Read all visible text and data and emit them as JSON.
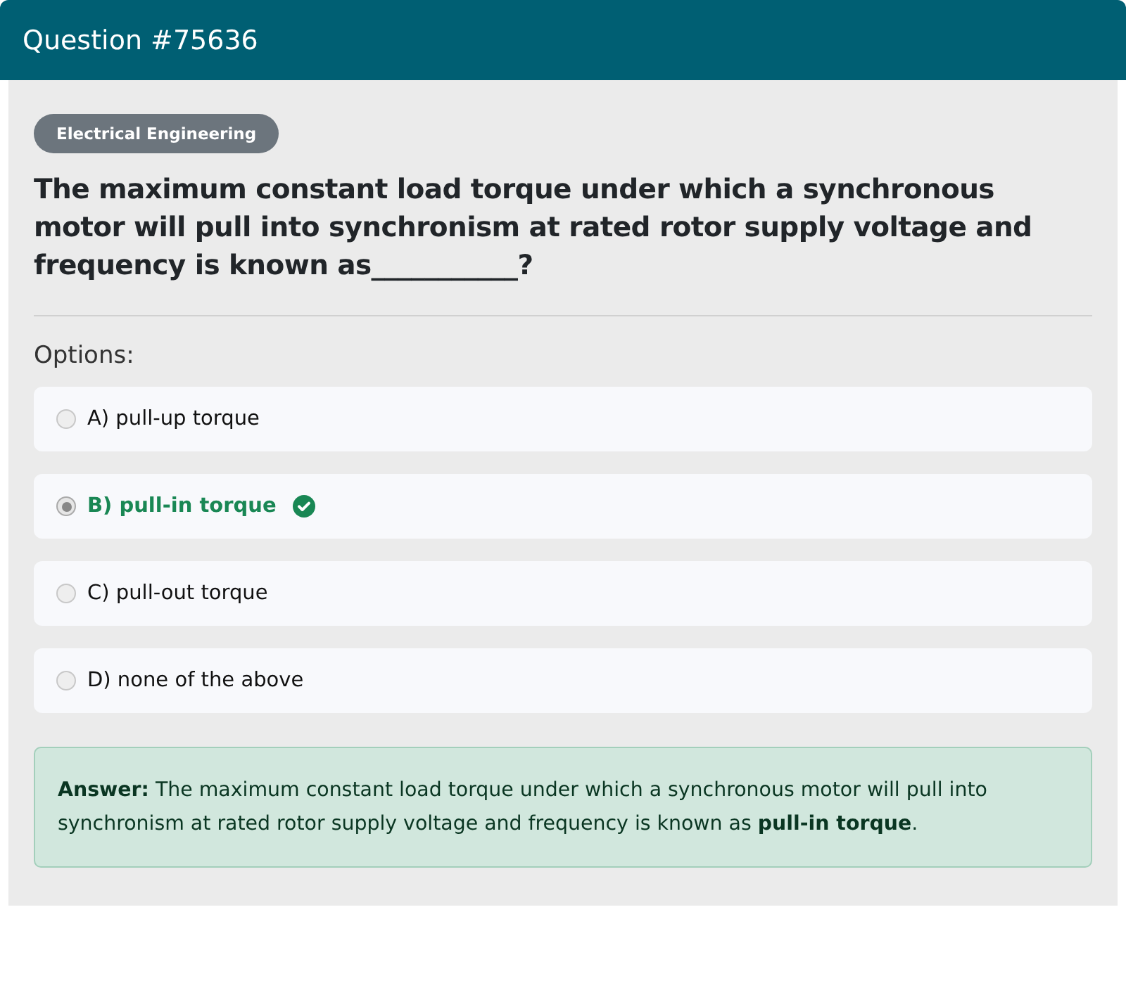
{
  "header": {
    "title": "Question #75636"
  },
  "category": "Electrical Engineering",
  "question": "The maximum constant load torque under which a synchronous motor will pull into synchronism at rated rotor supply voltage and frequency is known as___________?",
  "options_label": "Options:",
  "options": [
    {
      "text": "A) pull-up torque",
      "selected": false,
      "correct": false
    },
    {
      "text": "B) pull-in torque",
      "selected": true,
      "correct": true
    },
    {
      "text": "C) pull-out torque",
      "selected": false,
      "correct": false
    },
    {
      "text": "D) none of the above",
      "selected": false,
      "correct": false
    }
  ],
  "answer": "**Answer:** The maximum constant load torque under which a synchronous motor will pull into synchronism at rated rotor supply voltage and frequency is known as **pull-in torque**."
}
